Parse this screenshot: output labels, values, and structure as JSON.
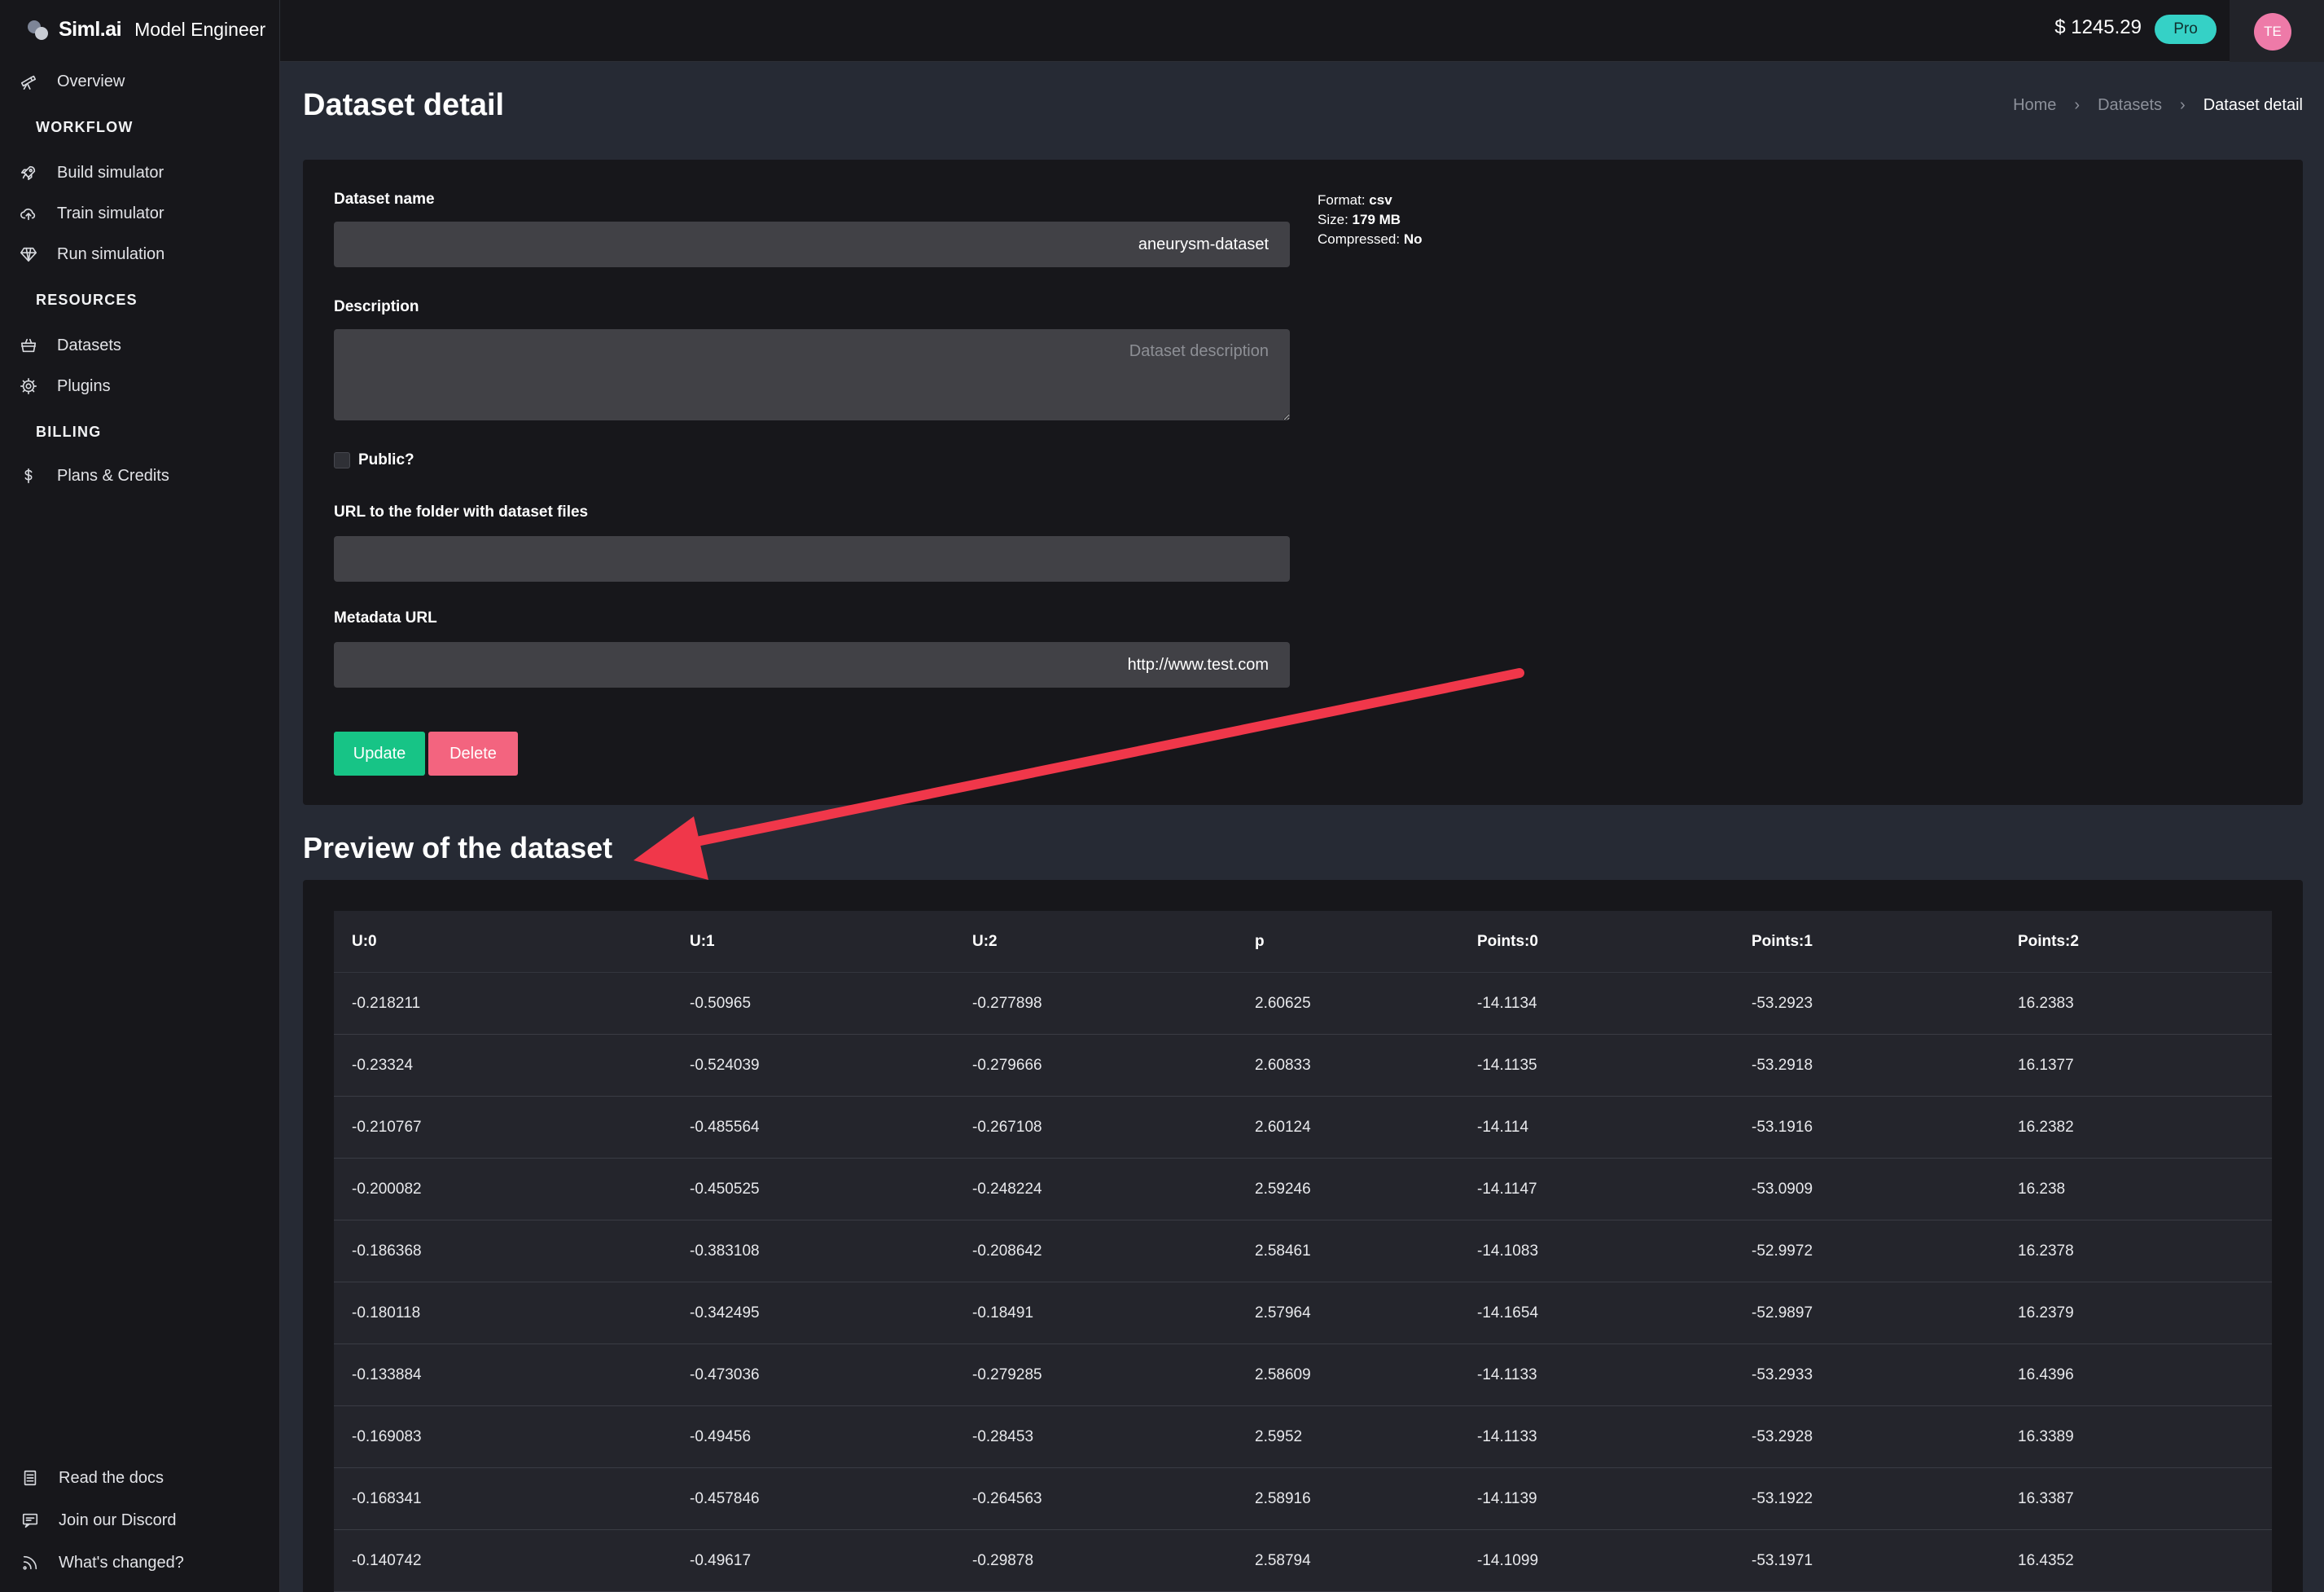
{
  "brand": {
    "name": "Siml.ai",
    "subtitle": "Model Engineer"
  },
  "sidebar": {
    "overview": {
      "label": "Overview",
      "icon": "telescope-icon"
    },
    "workflow_heading": "WORKFLOW",
    "workflow": [
      {
        "label": "Build simulator",
        "icon": "rocket-icon"
      },
      {
        "label": "Train simulator",
        "icon": "cloud-upload-icon"
      },
      {
        "label": "Run simulation",
        "icon": "diamond-icon"
      }
    ],
    "resources_heading": "RESOURCES",
    "resources": [
      {
        "label": "Datasets",
        "icon": "basket-icon"
      },
      {
        "label": "Plugins",
        "icon": "gear-icon"
      }
    ],
    "billing_heading": "BILLING",
    "billing": [
      {
        "label": "Plans & Credits",
        "icon": "dollar-icon"
      }
    ],
    "footer": [
      {
        "label": "Read the docs",
        "icon": "document-icon"
      },
      {
        "label": "Join our Discord",
        "icon": "chat-icon"
      },
      {
        "label": "What's changed?",
        "icon": "rss-icon"
      }
    ]
  },
  "topbar": {
    "balance": "$ 1245.29",
    "plan_badge": "Pro",
    "avatar_initials": "TE"
  },
  "page": {
    "title": "Dataset detail",
    "breadcrumb": [
      "Home",
      "Datasets",
      "Dataset detail"
    ]
  },
  "form": {
    "name_label": "Dataset name",
    "name_value": "aneurysm-dataset",
    "description_label": "Description",
    "description_placeholder": "Dataset description",
    "public_label": "Public?",
    "url_label": "URL to the folder with dataset files",
    "url_value": "",
    "metadata_label": "Metadata URL",
    "metadata_value": "http://www.test.com",
    "update_label": "Update",
    "delete_label": "Delete"
  },
  "meta": {
    "format_key": "Format:",
    "format_value": "csv",
    "size_key": "Size:",
    "size_value": "179 MB",
    "compressed_key": "Compressed:",
    "compressed_value": "No"
  },
  "preview": {
    "title": "Preview of the dataset",
    "columns": [
      "U:0",
      "U:1",
      "U:2",
      "p",
      "Points:0",
      "Points:1",
      "Points:2"
    ],
    "rows": [
      [
        "-0.218211",
        "-0.50965",
        "-0.277898",
        "2.60625",
        "-14.1134",
        "-53.2923",
        "16.2383"
      ],
      [
        "-0.23324",
        "-0.524039",
        "-0.279666",
        "2.60833",
        "-14.1135",
        "-53.2918",
        "16.1377"
      ],
      [
        "-0.210767",
        "-0.485564",
        "-0.267108",
        "2.60124",
        "-14.114",
        "-53.1916",
        "16.2382"
      ],
      [
        "-0.200082",
        "-0.450525",
        "-0.248224",
        "2.59246",
        "-14.1147",
        "-53.0909",
        "16.238"
      ],
      [
        "-0.186368",
        "-0.383108",
        "-0.208642",
        "2.58461",
        "-14.1083",
        "-52.9972",
        "16.2378"
      ],
      [
        "-0.180118",
        "-0.342495",
        "-0.18491",
        "2.57964",
        "-14.1654",
        "-52.9897",
        "16.2379"
      ],
      [
        "-0.133884",
        "-0.473036",
        "-0.279285",
        "2.58609",
        "-14.1133",
        "-53.2933",
        "16.4396"
      ],
      [
        "-0.169083",
        "-0.49456",
        "-0.28453",
        "2.5952",
        "-14.1133",
        "-53.2928",
        "16.3389"
      ],
      [
        "-0.168341",
        "-0.457846",
        "-0.264563",
        "2.58916",
        "-14.1139",
        "-53.1922",
        "16.3387"
      ],
      [
        "-0.140742",
        "-0.49617",
        "-0.29878",
        "2.58794",
        "-14.1099",
        "-53.1971",
        "16.4352"
      ]
    ]
  },
  "colors": {
    "accent_green": "#17c486",
    "accent_red": "#f3647f",
    "pro_badge": "#35d1c6",
    "avatar": "#ee7aa8",
    "annotation_arrow": "#f0374a"
  }
}
